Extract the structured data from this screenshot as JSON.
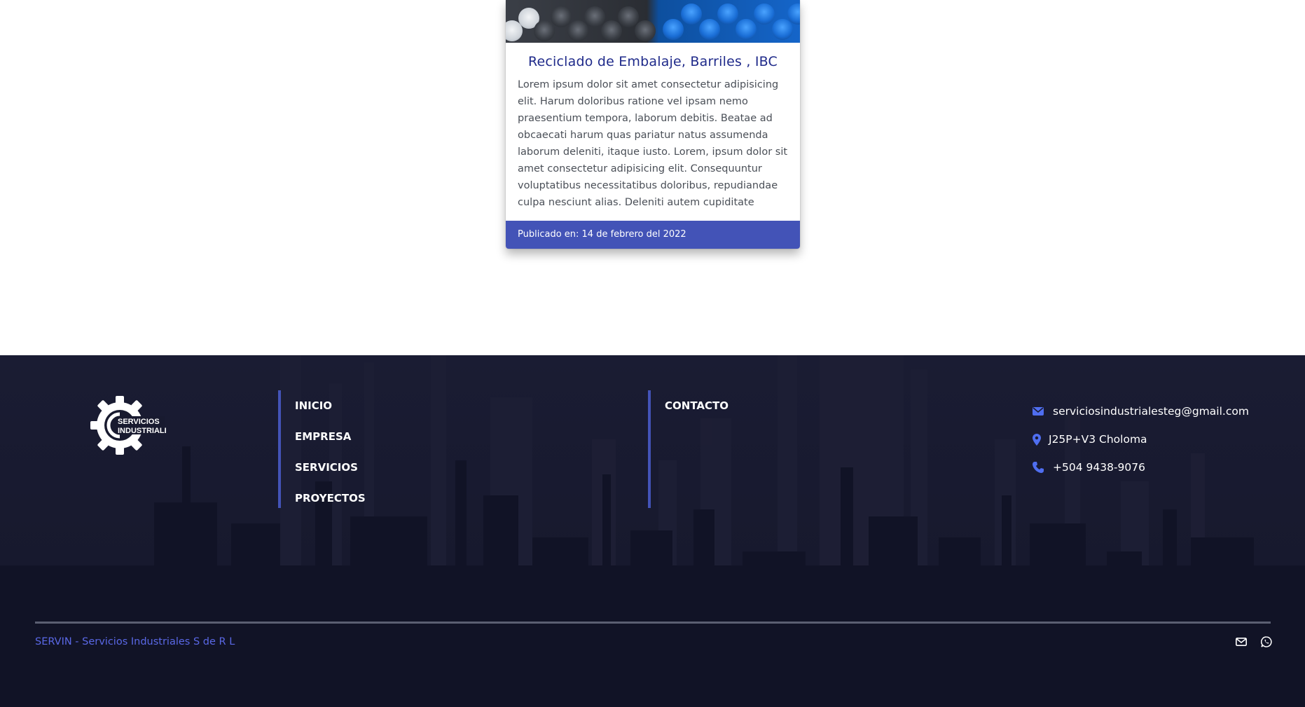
{
  "card": {
    "image_alt": "Barriles industriales",
    "title": "Reciclado de Embalaje, Barriles , IBC",
    "text": "Lorem ipsum dolor sit amet consectetur adipisicing elit. Harum doloribus ratione vel ipsam nemo praesentium tempora, laborum debitis. Beatae ad obcaecati harum quas pariatur natus assumenda laborum deleniti, itaque iusto. Lorem, ipsum dolor sit amet consectetur adipisicing elit. Consequuntur voluptatibus necessitatibus doloribus, repudiandae culpa nesciunt alias. Deleniti autem cupiditate",
    "published": "Publicado en: 14 de febrero del 2022"
  },
  "footer": {
    "logo_text_1": "SERVICIOS",
    "logo_text_2": "INDUSTRIALES",
    "nav_col1": [
      "INICIO",
      "EMPRESA",
      "SERVICIOS",
      "PROYECTOS"
    ],
    "nav_col2": [
      "CONTACTO"
    ],
    "contact": {
      "email": "serviciosindustrialesteg@gmail.com",
      "address": "J25P+V3 Choloma",
      "phone": "+504 9438-9076"
    },
    "copyright": "SERVIN - Servicios Industriales S de R L",
    "social_icons": [
      "envelope-icon",
      "whatsapp-icon"
    ]
  },
  "colors": {
    "accent": "#4353b7",
    "footer_bg": "#181a2f",
    "title": "#1f2a8a",
    "copyright": "#5a68e6"
  }
}
